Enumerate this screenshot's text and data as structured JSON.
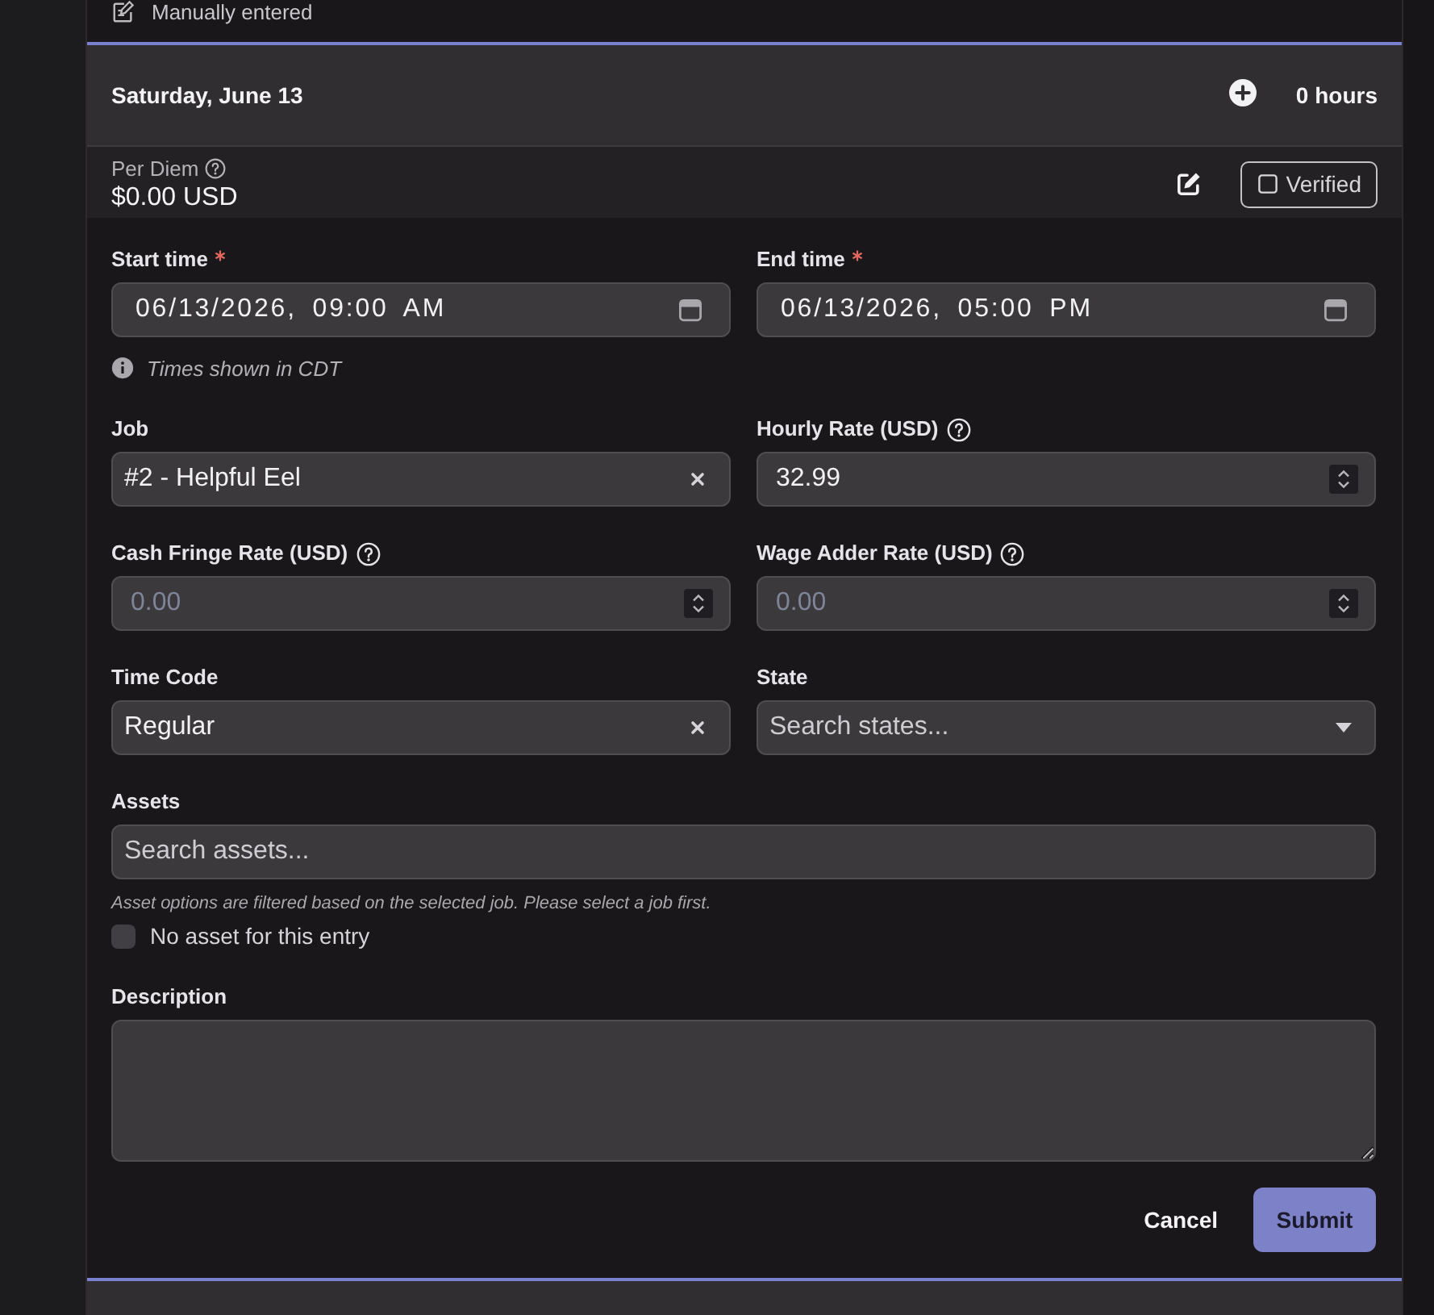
{
  "previous_entry": {
    "source": "Manually entered"
  },
  "day": {
    "title": "Saturday, June 13",
    "hours": "0 hours"
  },
  "per_diem": {
    "label": "Per Diem",
    "help": true,
    "amount": "$0.00 USD",
    "verified": {
      "label": "Verified",
      "checked": false
    }
  },
  "form": {
    "rows": [
      [
        {
          "kind": "datetime",
          "label": "Start time",
          "required": true,
          "help": false,
          "value": "06/13/2026, 09:00 AM",
          "note": "Times shown in CDT"
        },
        {
          "kind": "datetime",
          "label": "End time",
          "required": true,
          "help": false,
          "value": "06/13/2026, 05:00 PM"
        }
      ],
      [
        {
          "kind": "select",
          "label": "Job",
          "required": false,
          "help": false,
          "value": "#2 - Helpful Eel",
          "clearable": true
        },
        {
          "kind": "number",
          "label": "Hourly Rate (USD)",
          "required": false,
          "help": true,
          "value": "32.99"
        }
      ],
      [
        {
          "kind": "number",
          "label": "Cash Fringe Rate (USD)",
          "required": false,
          "help": true,
          "placeholder": "0.00"
        },
        {
          "kind": "number",
          "label": "Wage Adder Rate (USD)",
          "required": false,
          "help": true,
          "placeholder": "0.00"
        }
      ],
      [
        {
          "kind": "select",
          "label": "Time Code",
          "required": false,
          "help": false,
          "value": "Regular",
          "clearable": true
        },
        {
          "kind": "select",
          "label": "State",
          "required": false,
          "help": false,
          "placeholder": "Search states...",
          "clearable": false
        }
      ],
      [
        {
          "kind": "search",
          "label": "Assets",
          "required": false,
          "help": false,
          "placeholder": "Search assets...",
          "hint": "Asset options are filtered based on the selected job. Please select a job first.",
          "option": {
            "label": "No asset for this entry",
            "checked": false
          }
        }
      ],
      [
        {
          "kind": "textarea",
          "label": "Description",
          "required": false,
          "help": false
        }
      ]
    ],
    "actions": [
      {
        "kind": "secondary",
        "label": "Cancel"
      },
      {
        "kind": "primary",
        "label": "Submit"
      }
    ]
  }
}
